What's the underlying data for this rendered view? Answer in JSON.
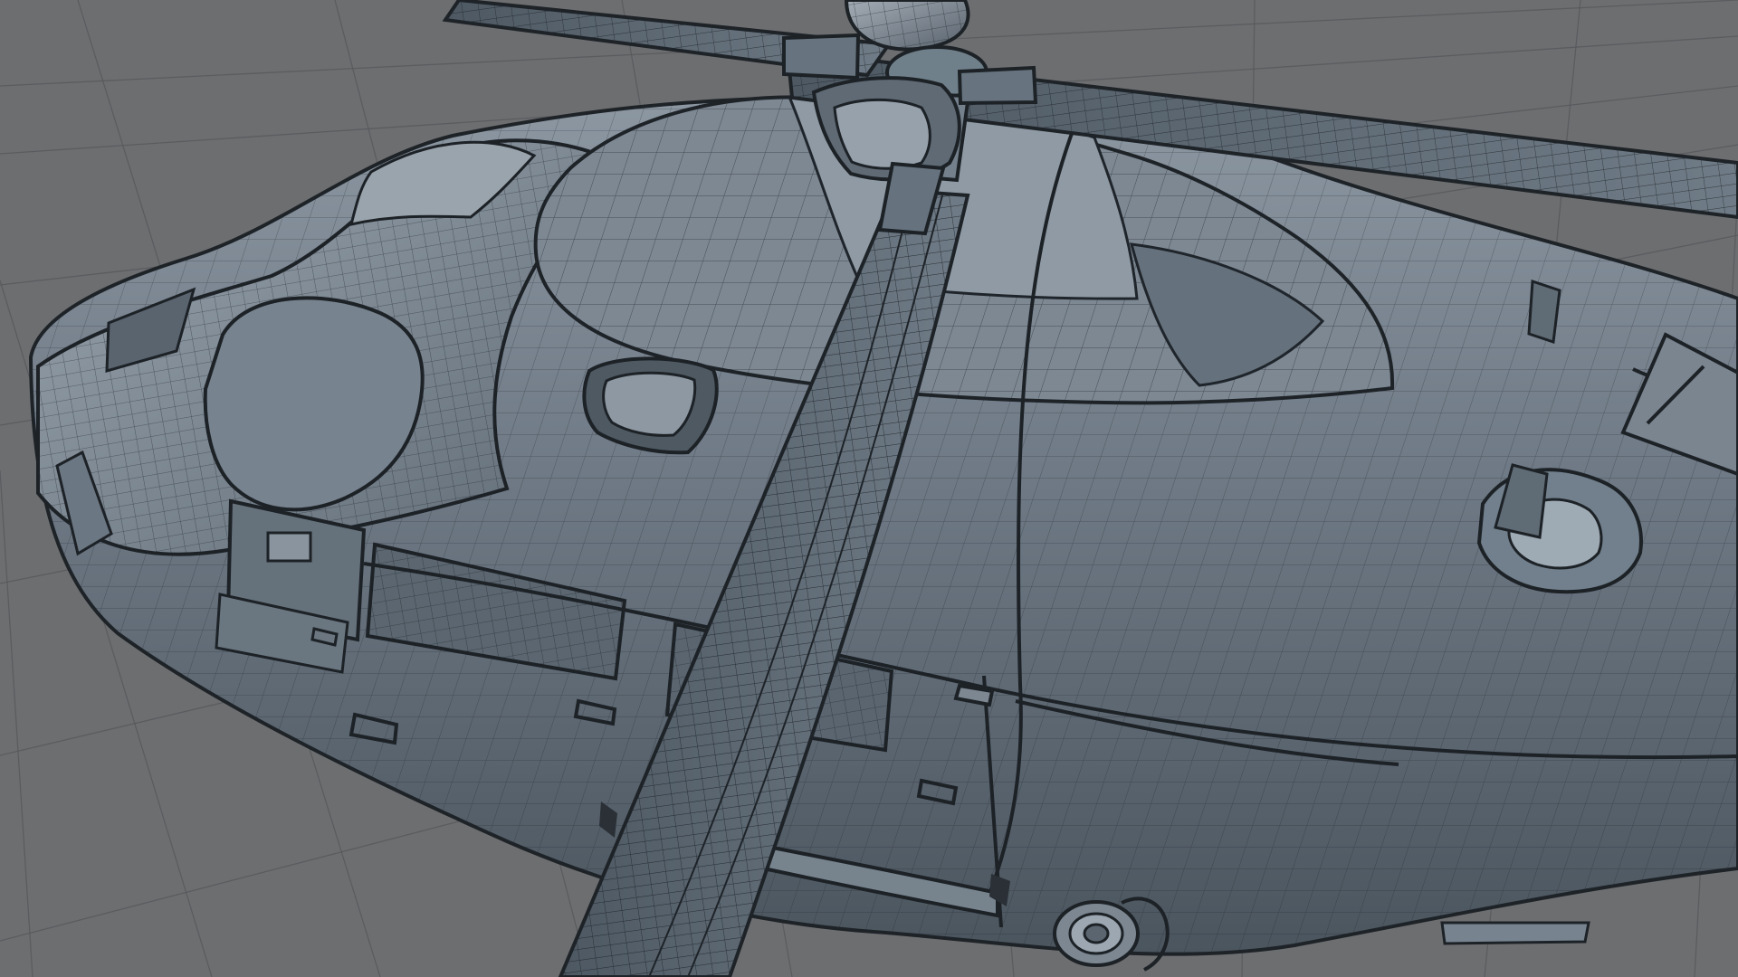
{
  "viewport": {
    "background_color": "#6d6e70",
    "grid_color": "#55575a",
    "mesh_fill_light": "#8b96a1",
    "mesh_fill_mid": "#66717c",
    "mesh_fill_dark": "#3f4850",
    "wireframe_color": "#1e2328",
    "rotor_fill": "#5d6872",
    "shown_icons": []
  }
}
